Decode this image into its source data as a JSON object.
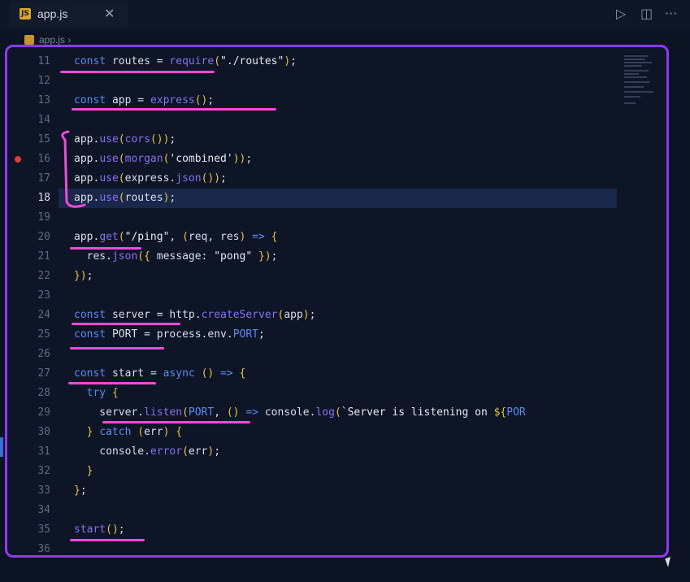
{
  "tab": {
    "file_name": "app.js",
    "icon_text": "JS",
    "close_glyph": "✕"
  },
  "toolbar": {
    "run_glyph": "▷",
    "split_glyph": "◫",
    "more_glyph": "···"
  },
  "breadcrumb": {
    "file_name": "app.js",
    "separator": "›"
  },
  "editor": {
    "active_line": 18,
    "breakpoint_line": 16,
    "lines": [
      {
        "number": "11",
        "tokens": [
          [
            "k",
            "const"
          ],
          [
            "v",
            " routes "
          ],
          [
            "v",
            "= "
          ],
          [
            "f",
            "require"
          ],
          [
            "p",
            "("
          ],
          [
            "s",
            "\"./routes\""
          ],
          [
            "p",
            ")"
          ],
          [
            "v",
            ";"
          ]
        ]
      },
      {
        "number": "12",
        "tokens": []
      },
      {
        "number": "13",
        "tokens": [
          [
            "k",
            "const"
          ],
          [
            "v",
            " app "
          ],
          [
            "v",
            "= "
          ],
          [
            "f",
            "express"
          ],
          [
            "p",
            "()"
          ],
          [
            "v",
            ";"
          ]
        ]
      },
      {
        "number": "14",
        "tokens": []
      },
      {
        "number": "15",
        "tokens": [
          [
            "v",
            "app."
          ],
          [
            "f",
            "use"
          ],
          [
            "p",
            "("
          ],
          [
            "f",
            "cors"
          ],
          [
            "p",
            "()"
          ],
          [
            "p",
            ")"
          ],
          [
            "v",
            ";"
          ]
        ]
      },
      {
        "number": "16",
        "tokens": [
          [
            "v",
            "app."
          ],
          [
            "f",
            "use"
          ],
          [
            "p",
            "("
          ],
          [
            "f",
            "morgan"
          ],
          [
            "p",
            "("
          ],
          [
            "s",
            "'combined'"
          ],
          [
            "p",
            "))"
          ],
          [
            "v",
            ";"
          ]
        ]
      },
      {
        "number": "17",
        "tokens": [
          [
            "v",
            "app."
          ],
          [
            "f",
            "use"
          ],
          [
            "p",
            "("
          ],
          [
            "v",
            "express."
          ],
          [
            "f",
            "json"
          ],
          [
            "p",
            "()"
          ],
          [
            "p",
            ")"
          ],
          [
            "v",
            ";"
          ]
        ]
      },
      {
        "number": "18",
        "tokens": [
          [
            "v",
            "app."
          ],
          [
            "f",
            "use"
          ],
          [
            "p",
            "("
          ],
          [
            "v",
            "routes"
          ],
          [
            "p",
            ")"
          ],
          [
            "v",
            ";"
          ]
        ]
      },
      {
        "number": "19",
        "tokens": []
      },
      {
        "number": "20",
        "tokens": [
          [
            "v",
            "app."
          ],
          [
            "f",
            "get"
          ],
          [
            "p",
            "("
          ],
          [
            "s",
            "\"/ping\""
          ],
          [
            "v",
            ", "
          ],
          [
            "p",
            "("
          ],
          [
            "v",
            "req, res"
          ],
          [
            "p",
            ")"
          ],
          [
            "k",
            " => "
          ],
          [
            "p",
            "{"
          ]
        ]
      },
      {
        "number": "21",
        "tokens": [
          [
            "v",
            "  res."
          ],
          [
            "f",
            "json"
          ],
          [
            "p",
            "("
          ],
          [
            "p",
            "{"
          ],
          [
            "v",
            " message: "
          ],
          [
            "s",
            "\"pong\""
          ],
          [
            "v",
            " "
          ],
          [
            "p",
            "}"
          ],
          [
            "p",
            ")"
          ],
          [
            "v",
            ";"
          ]
        ]
      },
      {
        "number": "22",
        "tokens": [
          [
            "p",
            "})"
          ],
          [
            "v",
            ";"
          ]
        ]
      },
      {
        "number": "23",
        "tokens": []
      },
      {
        "number": "24",
        "tokens": [
          [
            "k",
            "const"
          ],
          [
            "v",
            " server "
          ],
          [
            "v",
            "= "
          ],
          [
            "v",
            "http."
          ],
          [
            "f",
            "createServer"
          ],
          [
            "p",
            "("
          ],
          [
            "v",
            "app"
          ],
          [
            "p",
            ")"
          ],
          [
            "v",
            ";"
          ]
        ]
      },
      {
        "number": "25",
        "tokens": [
          [
            "k",
            "const"
          ],
          [
            "v",
            " PORT "
          ],
          [
            "v",
            "= "
          ],
          [
            "v",
            "process.env."
          ],
          [
            "k",
            "PORT"
          ],
          [
            "v",
            ";"
          ]
        ]
      },
      {
        "number": "26",
        "tokens": []
      },
      {
        "number": "27",
        "tokens": [
          [
            "k",
            "const"
          ],
          [
            "v",
            " start "
          ],
          [
            "v",
            "= "
          ],
          [
            "k",
            "async"
          ],
          [
            "v",
            " "
          ],
          [
            "p",
            "()"
          ],
          [
            "k",
            " => "
          ],
          [
            "p",
            "{"
          ]
        ]
      },
      {
        "number": "28",
        "tokens": [
          [
            "k",
            "  try"
          ],
          [
            "v",
            " "
          ],
          [
            "p",
            "{"
          ]
        ]
      },
      {
        "number": "29",
        "tokens": [
          [
            "v",
            "    server."
          ],
          [
            "f",
            "listen"
          ],
          [
            "p",
            "("
          ],
          [
            "k",
            "PORT"
          ],
          [
            "v",
            ", "
          ],
          [
            "p",
            "()"
          ],
          [
            "k",
            " => "
          ],
          [
            "v",
            "console."
          ],
          [
            "f",
            "log"
          ],
          [
            "p",
            "("
          ],
          [
            "s",
            "`Server is listening on "
          ],
          [
            "p",
            "${"
          ],
          [
            "k",
            "POR"
          ]
        ]
      },
      {
        "number": "30",
        "tokens": [
          [
            "p",
            "  } "
          ],
          [
            "k",
            "catch"
          ],
          [
            "v",
            " "
          ],
          [
            "p",
            "("
          ],
          [
            "v",
            "err"
          ],
          [
            "p",
            ")"
          ],
          [
            "v",
            " "
          ],
          [
            "p",
            "{"
          ]
        ]
      },
      {
        "number": "31",
        "tokens": [
          [
            "v",
            "    console."
          ],
          [
            "f",
            "error"
          ],
          [
            "p",
            "("
          ],
          [
            "v",
            "err"
          ],
          [
            "p",
            ")"
          ],
          [
            "v",
            ";"
          ]
        ]
      },
      {
        "number": "32",
        "tokens": [
          [
            "p",
            "  }"
          ]
        ]
      },
      {
        "number": "33",
        "tokens": [
          [
            "p",
            "}"
          ],
          [
            "v",
            ";"
          ]
        ]
      },
      {
        "number": "34",
        "tokens": []
      },
      {
        "number": "35",
        "tokens": [
          [
            "f",
            "start"
          ],
          [
            "p",
            "()"
          ],
          [
            "v",
            ";"
          ]
        ]
      },
      {
        "number": "36",
        "tokens": []
      }
    ]
  },
  "colors": {
    "keyword": "#5b8cf0",
    "function": "#8a6ff0",
    "string": "#e6e9ee",
    "punctuation": "#e8c33c",
    "annotation_frame": "#8a3cf0",
    "annotation_underline": "#f04ad8"
  }
}
